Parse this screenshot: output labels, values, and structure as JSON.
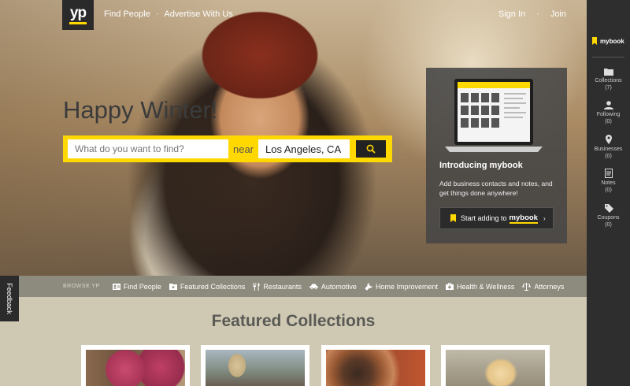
{
  "logo": {
    "text": "yp"
  },
  "topnav": {
    "find_people": "Find People",
    "separator": "·",
    "advertise": "Advertise With Us"
  },
  "auth": {
    "sign_in": "Sign In",
    "separator": "·",
    "join": "Join"
  },
  "hero": {
    "headline": "Happy Winter!"
  },
  "search": {
    "what_placeholder": "What do you want to find?",
    "near_label": "near",
    "where_value": "Los Angeles, CA",
    "button_icon": "search-icon"
  },
  "promo": {
    "title": "Introducing mybook",
    "description": "Add business contacts and notes, and get things done anywhere!",
    "cta_prefix": "Start adding to",
    "cta_brand": "mybook",
    "cta_chevron": "›"
  },
  "sidebar": {
    "title": "mybook",
    "items": [
      {
        "label": "Collections",
        "count": "(7)",
        "icon": "folder-icon"
      },
      {
        "label": "Following",
        "count": "(0)",
        "icon": "person-icon"
      },
      {
        "label": "Businesses",
        "count": "(0)",
        "icon": "map-pin-icon"
      },
      {
        "label": "Notes",
        "count": "(0)",
        "icon": "note-icon"
      },
      {
        "label": "Coupons",
        "count": "(0)",
        "icon": "tag-icon"
      }
    ]
  },
  "browse": {
    "label": "BROWSE YP",
    "items": [
      {
        "label": "Find People",
        "icon": "contact-card-icon"
      },
      {
        "label": "Featured Collections",
        "icon": "folder-star-icon"
      },
      {
        "label": "Restaurants",
        "icon": "fork-knife-icon"
      },
      {
        "label": "Automotive",
        "icon": "car-icon"
      },
      {
        "label": "Home Improvement",
        "icon": "wrench-icon"
      },
      {
        "label": "Health & Wellness",
        "icon": "medical-kit-icon"
      },
      {
        "label": "Attorneys",
        "icon": "scales-icon"
      }
    ]
  },
  "feedback": {
    "label": "Feedback"
  },
  "featured": {
    "title": "Featured Collections"
  },
  "colors": {
    "accent": "#ffd800",
    "dark": "#2e2e2e",
    "browse_bar": "#8d8b7d"
  }
}
